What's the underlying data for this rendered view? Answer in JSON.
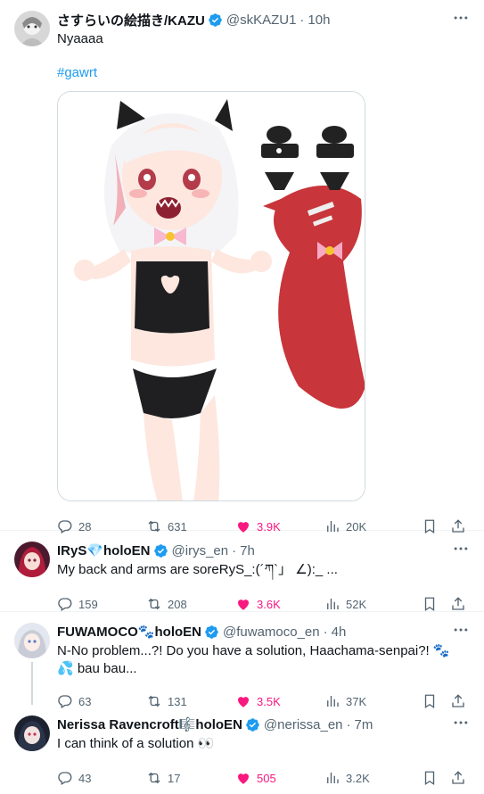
{
  "posts": [
    {
      "author": "さすらいの絵描き/KAZU",
      "handle": "@skKAZU1",
      "time": "10h",
      "text": "Nyaaaa",
      "hashtag": "#gawrt",
      "replies": "28",
      "reposts": "631",
      "likes": "3.9K",
      "views": "20K"
    },
    {
      "author": "IRyS💎holoEN",
      "handle": "@irys_en",
      "time": "7h",
      "text": "My back and arms are soreRyS_:(´ཀ`」 ∠):_ ...",
      "replies": "159",
      "reposts": "208",
      "likes": "3.6K",
      "views": "52K"
    },
    {
      "author": "FUWAMOCO🐾holoEN",
      "handle": "@fuwamoco_en",
      "time": "4h",
      "text": "N-No problem...?! Do you have a solution, Haachama-senpai?! 🐾💦 bau bau...",
      "replies": "63",
      "reposts": "131",
      "likes": "3.5K",
      "views": "37K"
    },
    {
      "author": "Nerissa Ravencroft🎼holoEN",
      "handle": "@nerissa_en",
      "time": "7m",
      "text": "I can think of a solution 👀",
      "replies": "43",
      "reposts": "17",
      "likes": "505",
      "views": "3.2K"
    }
  ],
  "colors": {
    "accent": "#1d9bf0",
    "like": "#f91880",
    "muted": "#536471",
    "divider": "#eff3f4"
  },
  "icons": [
    "verified-badge-icon",
    "more-icon",
    "reply-icon",
    "repost-icon",
    "like-icon",
    "views-icon",
    "bookmark-icon",
    "share-icon"
  ]
}
